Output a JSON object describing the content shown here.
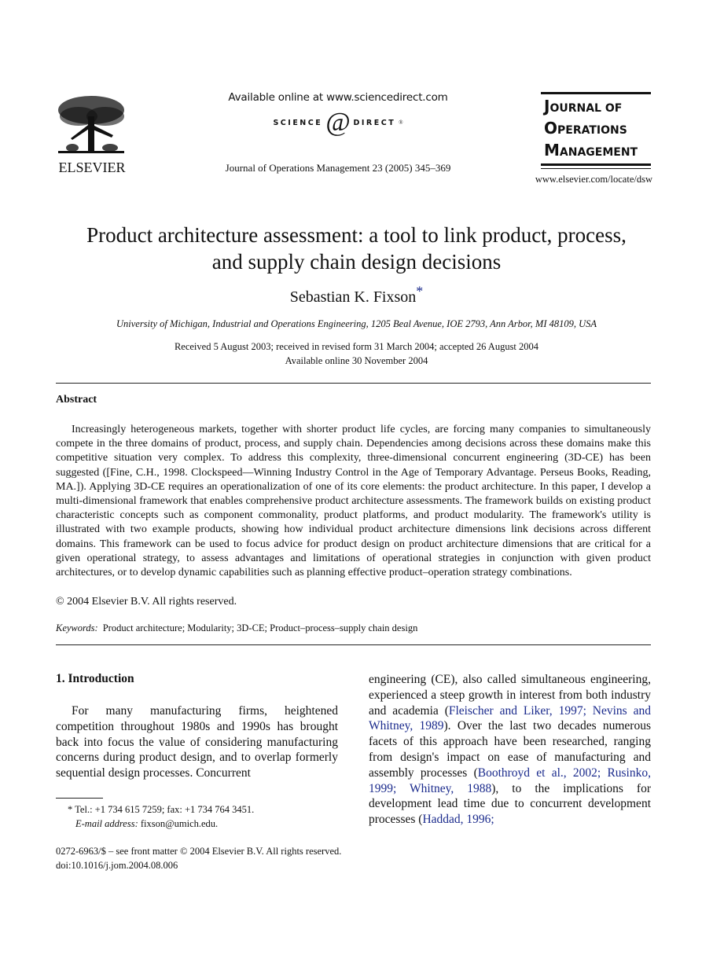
{
  "header": {
    "publisher_logo_text": "ELSEVIER",
    "available_online": "Available online at www.sciencedirect.com",
    "sciencedirect_logo": {
      "left_word": "SCIENCE",
      "at_symbol": "@",
      "right_word": "DIRECT",
      "mark": "®"
    },
    "journal_reference": "Journal of Operations Management 23 (2005) 345–369",
    "journal_logo": {
      "lines": [
        {
          "initial": "J",
          "rest": "OURNAL OF"
        },
        {
          "initial": "O",
          "rest": "PERATIONS"
        },
        {
          "initial": "M",
          "rest": "ANAGEMENT"
        }
      ]
    },
    "journal_url": "www.elsevier.com/locate/dsw"
  },
  "article": {
    "title_line1": "Product architecture assessment: a tool to link product, process,",
    "title_line2": "and supply chain design decisions",
    "author": "Sebastian K. Fixson",
    "author_marker": "*",
    "affiliation": "University of Michigan, Industrial and Operations Engineering, 1205 Beal Avenue, IOE 2793, Ann Arbor, MI 48109, USA",
    "received": "Received 5 August 2003; received in revised form 31 March 2004; accepted 26 August 2004",
    "available_online": "Available online 30 November 2004"
  },
  "abstract": {
    "heading": "Abstract",
    "body": "Increasingly heterogeneous markets, together with shorter product life cycles, are forcing many companies to simultaneously compete in the three domains of product, process, and supply chain. Dependencies among decisions across these domains make this competitive situation very complex. To address this complexity, three-dimensional concurrent engineering (3D-CE) has been suggested ([Fine, C.H., 1998. Clockspeed—Winning Industry Control in the Age of Temporary Advantage. Perseus Books, Reading, MA.]). Applying 3D-CE requires an operationalization of one of its core elements: the product architecture. In this paper, I develop a multi-dimensional framework that enables comprehensive product architecture assessments. The framework builds on existing product characteristic concepts such as component commonality, product platforms, and product modularity. The framework's utility is illustrated with two example products, showing how individual product architecture dimensions link decisions across different domains. This framework can be used to focus advice for product design on product architecture dimensions that are critical for a given operational strategy, to assess advantages and limitations of operational strategies in conjunction with given product architectures, or to develop dynamic capabilities such as planning effective product–operation strategy combinations.",
    "copyright": "© 2004 Elsevier B.V. All rights reserved.",
    "keywords_label": "Keywords:",
    "keywords": "Product architecture; Modularity; 3D-CE; Product–process–supply chain design"
  },
  "introduction": {
    "heading": "1.  Introduction",
    "left_text": "For many manufacturing firms, heightened competition throughout 1980s and 1990s has brought back into focus the value of considering manufacturing concerns during product design, and to overlap formerly sequential design processes. Concurrent",
    "right_segments": [
      {
        "text": "engineering (CE), also called simultaneous engineering, experienced a steep growth in interest from both industry and academia (",
        "cite": false
      },
      {
        "text": "Fleischer and Liker, 1997; Nevins and Whitney, 1989",
        "cite": true
      },
      {
        "text": "). Over the last two decades numerous facets of this approach have been researched, ranging from design's impact on ease of manufacturing and assembly processes (",
        "cite": false
      },
      {
        "text": "Boothroyd et al., 2002; Rusinko, 1999; Whitney, 1988",
        "cite": true
      },
      {
        "text": "), to the implications for development lead time due to concurrent development processes (",
        "cite": false
      },
      {
        "text": "Haddad, 1996;",
        "cite": true
      }
    ]
  },
  "footnote": {
    "marker": "*",
    "contact": "Tel.: +1 734 615 7259; fax: +1 734 764 3451.",
    "email_label": "E-mail address:",
    "email": "fixson@umich.edu."
  },
  "front_matter": {
    "issn_line": "0272-6963/$ – see front matter © 2004 Elsevier B.V. All rights reserved.",
    "doi": "doi:10.1016/j.jom.2004.08.006"
  },
  "colors": {
    "citation_link": "#1a2a8c",
    "text": "#111111"
  }
}
